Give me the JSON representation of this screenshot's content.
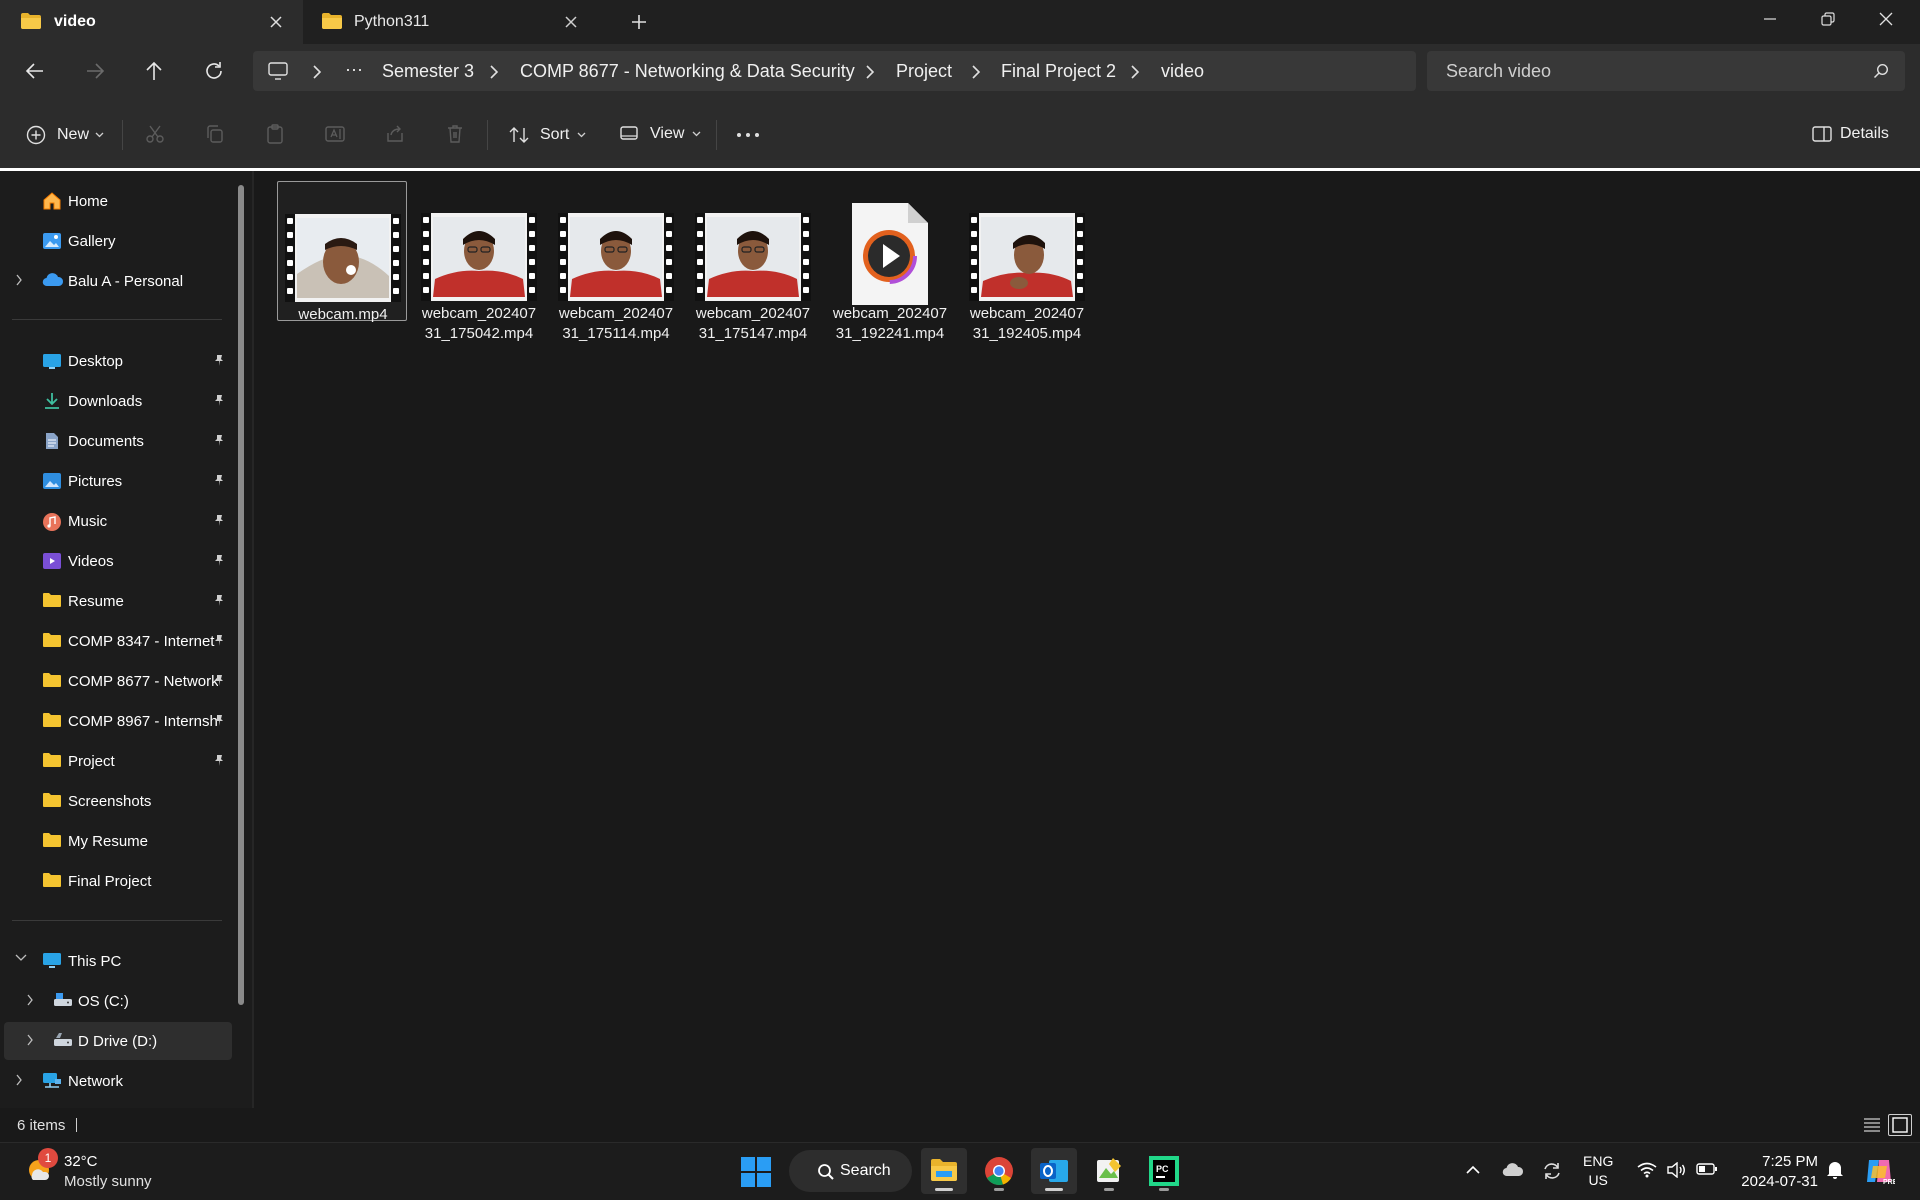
{
  "tabs": [
    {
      "label": "video",
      "active": true
    },
    {
      "label": "Python311",
      "active": false
    }
  ],
  "address": {
    "crumbs": [
      "Semester 3",
      "COMP 8677 - Networking & Data Security",
      "Project",
      "Final Project 2",
      "video"
    ],
    "overflow": "···"
  },
  "search": {
    "placeholder": "Search video"
  },
  "commands": {
    "new": "New",
    "sort": "Sort",
    "view": "View",
    "more": "···",
    "details": "Details"
  },
  "sidebar": {
    "top": [
      {
        "label": "Home",
        "icon": "home-icon"
      },
      {
        "label": "Gallery",
        "icon": "gallery-icon"
      },
      {
        "label": "Balu A - Personal",
        "icon": "onedrive-cloud-icon"
      }
    ],
    "quick_access": [
      {
        "label": "Desktop",
        "icon": "desktop-icon"
      },
      {
        "label": "Downloads",
        "icon": "downloads-icon"
      },
      {
        "label": "Documents",
        "icon": "documents-icon"
      },
      {
        "label": "Pictures",
        "icon": "pictures-icon"
      },
      {
        "label": "Music",
        "icon": "music-icon"
      },
      {
        "label": "Videos",
        "icon": "videos-icon"
      },
      {
        "label": "Resume",
        "icon": "folder-icon"
      },
      {
        "label": "COMP 8347 - Internet",
        "icon": "folder-icon"
      },
      {
        "label": "COMP 8677 - Network",
        "icon": "folder-icon"
      },
      {
        "label": "COMP 8967 - Internsh",
        "icon": "folder-icon"
      },
      {
        "label": "Project",
        "icon": "folder-icon"
      },
      {
        "label": "Screenshots",
        "icon": "folder-icon"
      },
      {
        "label": "My Resume",
        "icon": "folder-icon"
      },
      {
        "label": "Final Project",
        "icon": "folder-icon"
      }
    ],
    "this_pc": {
      "label": "This PC"
    },
    "drives": [
      {
        "label": "OS (C:)"
      },
      {
        "label": "D Drive (D:)"
      }
    ],
    "network": {
      "label": "Network"
    }
  },
  "files": [
    {
      "line1": "webcam.mp4",
      "line2": "",
      "type": "video-thumb",
      "selected": true
    },
    {
      "line1": "webcam_202407",
      "line2": "31_175042.mp4",
      "type": "video-thumb",
      "selected": false
    },
    {
      "line1": "webcam_202407",
      "line2": "31_175114.mp4",
      "type": "video-thumb",
      "selected": false
    },
    {
      "line1": "webcam_202407",
      "line2": "31_175147.mp4",
      "type": "video-thumb",
      "selected": false
    },
    {
      "line1": "webcam_202407",
      "line2": "31_192241.mp4",
      "type": "media-player-file-icon",
      "selected": false
    },
    {
      "line1": "webcam_202407",
      "line2": "31_192405.mp4",
      "type": "video-thumb",
      "selected": false
    }
  ],
  "status": {
    "count": "6 items"
  },
  "taskbar": {
    "weather": {
      "temp": "32°C",
      "condition": "Mostly sunny",
      "badge": "1"
    },
    "search_label": "Search",
    "lang": {
      "line1": "ENG",
      "line2": "US"
    },
    "clock": {
      "time": "7:25 PM",
      "date": "2024-07-31"
    }
  },
  "colors": {
    "accent": "#0078d4",
    "folder": "#f4c430",
    "window_bg": "#191919",
    "chrome_bg": "#2c2c2c"
  }
}
